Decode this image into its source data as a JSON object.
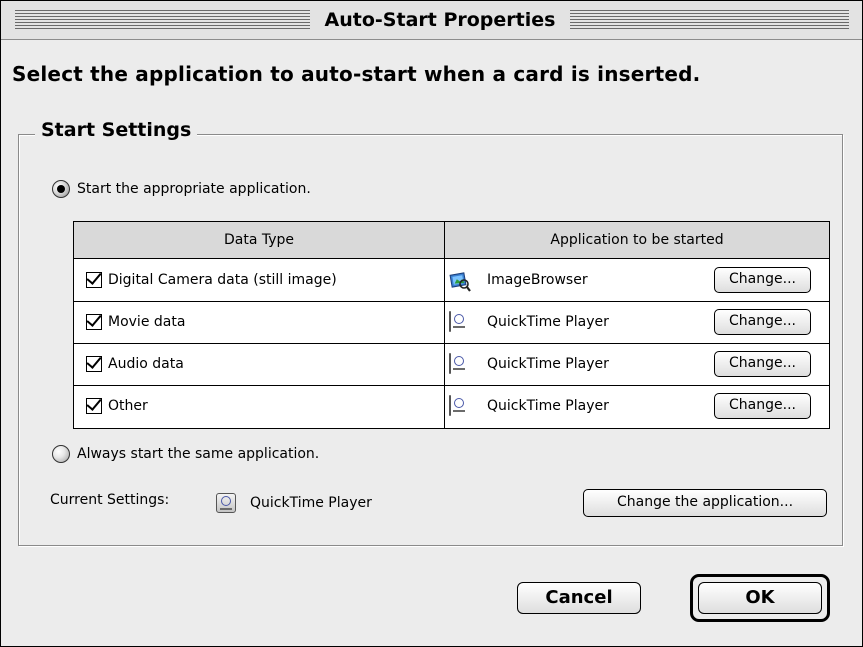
{
  "window": {
    "title": "Auto-Start Properties"
  },
  "instruction": "Select the application to auto-start when a card is inserted.",
  "start_settings": {
    "group_title": "Start Settings",
    "option_appropriate": "Start the appropriate application.",
    "option_same": "Always start the same application.",
    "selected_option": "appropriate"
  },
  "table": {
    "headers": [
      "Data Type",
      "Application to be started"
    ],
    "rows": [
      {
        "data_type": "Digital Camera data (still image)",
        "checked": true,
        "app": "ImageBrowser",
        "app_icon": "imagebrowser-icon",
        "button": "Change..."
      },
      {
        "data_type": "Movie data",
        "checked": true,
        "app": "QuickTime Player",
        "app_icon": "quicktime-icon",
        "button": "Change..."
      },
      {
        "data_type": "Audio data",
        "checked": true,
        "app": "QuickTime Player",
        "app_icon": "quicktime-icon",
        "button": "Change..."
      },
      {
        "data_type": "Other",
        "checked": true,
        "app": "QuickTime Player",
        "app_icon": "quicktime-icon",
        "button": "Change..."
      }
    ]
  },
  "current_settings": {
    "label": "Current Settings:",
    "app": "QuickTime Player",
    "app_icon": "quicktime-icon",
    "button": "Change the application..."
  },
  "buttons": {
    "cancel": "Cancel",
    "ok": "OK"
  }
}
